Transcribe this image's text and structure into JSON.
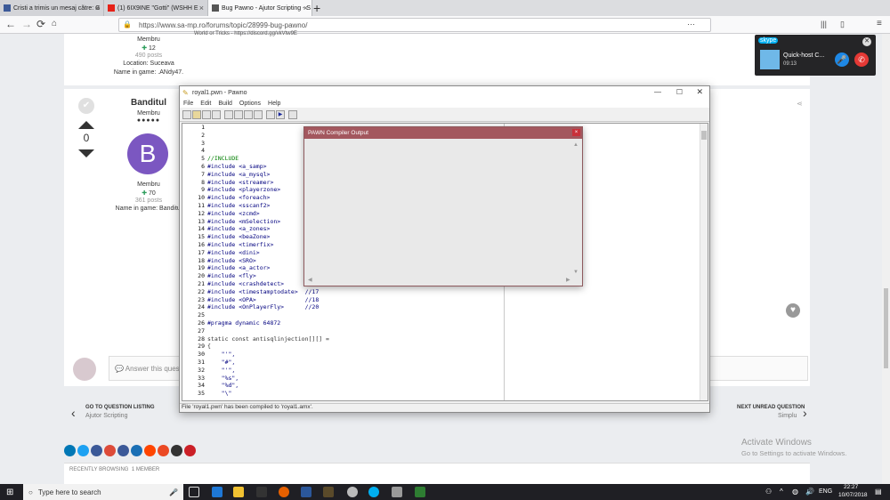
{
  "browser": {
    "tabs": [
      {
        "label": "Cristi a trimis un mesaj către: G",
        "favicon_color": "#3b5998",
        "active": false
      },
      {
        "label": "(1) 6IX9INE \"Gotti\" (WSHH E",
        "favicon_color": "#e62117",
        "active": false
      },
      {
        "label": "Bug Pawno - Ajutor Scripting - S",
        "favicon_color": "#555555",
        "active": true
      }
    ],
    "url": "https://www.sa-mp.ro/forums/topic/28999-bug-pawno/",
    "url_domain": "sa-mp.ro"
  },
  "post1": {
    "role": "Membru",
    "rep": "12",
    "posts": "490 posts",
    "location": "Location: Suceava",
    "name_in_game": "Name in game: .ANdy47.",
    "snippet": "World or Tricks - https://discord.gg/vkVtw9E"
  },
  "post2": {
    "username": "Banditul",
    "role": "Membru",
    "vote_count": "0",
    "avatar_letter": "B",
    "avatar_color": "#7b57c1",
    "role2": "Membru",
    "rep": "70",
    "posts": "361 posts",
    "name_in_game": "Name in game: Banditul"
  },
  "answer_placeholder": "Answer this questi",
  "prev_link": {
    "label": "GO TO QUESTION LISTING",
    "sub": "Ajutor Scripting"
  },
  "next_link": {
    "label": "NEXT UNREAD QUESTION",
    "sub": "Simplu"
  },
  "recently_browsing": "RECENTLY BROWSING",
  "member_count": "1 MEMBER",
  "activate": {
    "title": "Activate Windows",
    "sub": "Go to Settings to activate Windows."
  },
  "pawno": {
    "title": "royal1.pwn - Pawno",
    "menu": [
      "File",
      "Edit",
      "Build",
      "Options",
      "Help"
    ],
    "status": "File 'royal1.pwn' has been compiled to 'royal1.amx'.",
    "lines": [
      {
        "n": "1",
        "t": "",
        "c": ""
      },
      {
        "n": "2",
        "t": "",
        "c": ""
      },
      {
        "n": "3",
        "t": "",
        "c": ""
      },
      {
        "n": "4",
        "t": "",
        "c": ""
      },
      {
        "n": "5",
        "t": "//INCLUDE",
        "c": "cm"
      },
      {
        "n": "6",
        "t": "#include <a_samp>",
        "c": "kw"
      },
      {
        "n": "7",
        "t": "#include <a_mysql>",
        "c": "kw"
      },
      {
        "n": "8",
        "t": "#include <streamer>",
        "c": "kw"
      },
      {
        "n": "9",
        "t": "#include <playerzone>",
        "c": "kw"
      },
      {
        "n": "10",
        "t": "#include <foreach>",
        "c": "kw"
      },
      {
        "n": "11",
        "t": "#include <sscanf2>",
        "c": "kw"
      },
      {
        "n": "12",
        "t": "#include <zcmd>",
        "c": "kw"
      },
      {
        "n": "13",
        "t": "#include <mSelection>",
        "c": "kw"
      },
      {
        "n": "14",
        "t": "#include <a_zones>",
        "c": "kw"
      },
      {
        "n": "15",
        "t": "#include <beaZone>",
        "c": "kw"
      },
      {
        "n": "16",
        "t": "#include <timerfix>",
        "c": "kw"
      },
      {
        "n": "17",
        "t": "#include <dini>",
        "c": "kw"
      },
      {
        "n": "18",
        "t": "#include <SRO>",
        "c": "kw"
      },
      {
        "n": "19",
        "t": "#include <a_actor>",
        "c": "kw"
      },
      {
        "n": "20",
        "t": "#include <fly>",
        "c": "kw"
      },
      {
        "n": "21",
        "t": "#include <crashdetect>",
        "c": "kw"
      },
      {
        "n": "22",
        "t": "#include <timestamptodate>  //17",
        "c": "kw"
      },
      {
        "n": "23",
        "t": "#include <OPA>              //18",
        "c": "kw"
      },
      {
        "n": "24",
        "t": "#include <OnPlayerFly>      //20",
        "c": "kw"
      },
      {
        "n": "25",
        "t": "",
        "c": ""
      },
      {
        "n": "26",
        "t": "#pragma dynamic 64872",
        "c": "kw"
      },
      {
        "n": "27",
        "t": "",
        "c": ""
      },
      {
        "n": "28",
        "t": "static const antisqlinjection[][] =",
        "c": ""
      },
      {
        "n": "29",
        "t": "{",
        "c": ""
      },
      {
        "n": "30",
        "t": "    \"'\",",
        "c": "st"
      },
      {
        "n": "31",
        "t": "    \"#\",",
        "c": "st"
      },
      {
        "n": "32",
        "t": "    \"'\",",
        "c": "st"
      },
      {
        "n": "33",
        "t": "    \"%s\",",
        "c": "st"
      },
      {
        "n": "34",
        "t": "    \"%d\",",
        "c": "st"
      },
      {
        "n": "35",
        "t": "    \"\\\"",
        "c": "st"
      }
    ]
  },
  "compiler": {
    "title": "PAWN Compiler Output",
    "close": "×"
  },
  "skype": {
    "brand": "skype",
    "contact": "Quick-host C...",
    "time": "09:13"
  },
  "taskbar": {
    "search": "Type here to search",
    "lang": "ENG",
    "time": "22:27",
    "date": "10/07/2018"
  }
}
